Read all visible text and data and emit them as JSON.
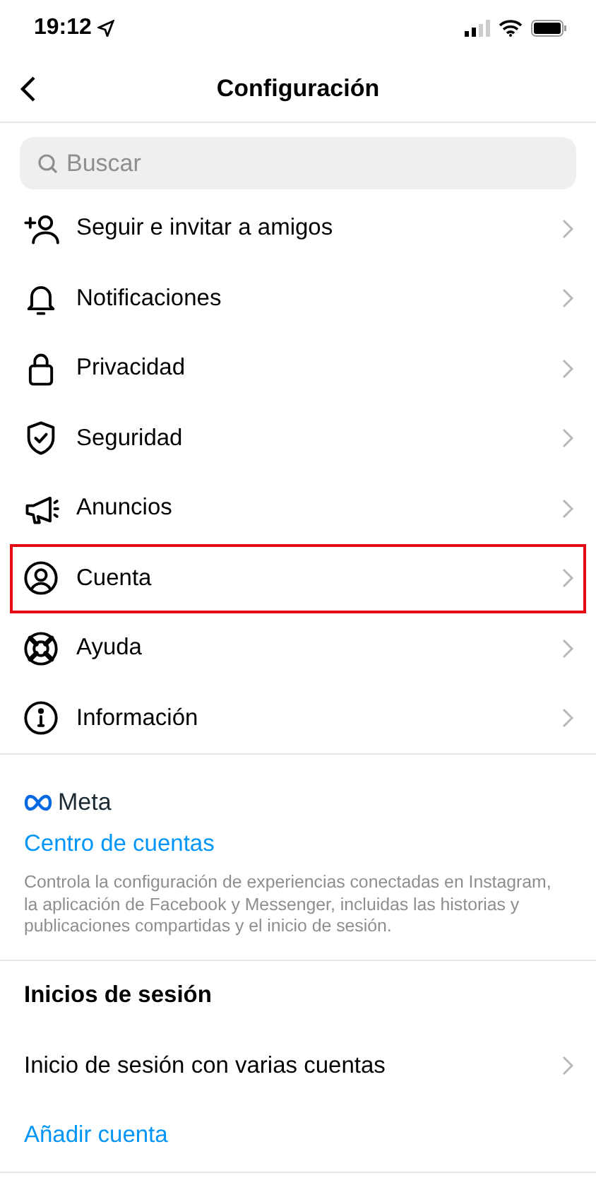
{
  "status_bar": {
    "time": "19:12"
  },
  "header": {
    "title": "Configuración"
  },
  "search": {
    "placeholder": "Buscar"
  },
  "menu": [
    {
      "label": "Seguir e invitar a amigos",
      "highlighted": false
    },
    {
      "label": "Notificaciones",
      "highlighted": false
    },
    {
      "label": "Privacidad",
      "highlighted": false
    },
    {
      "label": "Seguridad",
      "highlighted": false
    },
    {
      "label": "Anuncios",
      "highlighted": false
    },
    {
      "label": "Cuenta",
      "highlighted": true
    },
    {
      "label": "Ayuda",
      "highlighted": false
    },
    {
      "label": "Información",
      "highlighted": false
    }
  ],
  "meta": {
    "brand": "Meta",
    "link": "Centro de cuentas",
    "description": "Controla la configuración de experiencias conectadas en Instagram, la aplicación de Facebook y Messenger, incluidas las historias y publicaciones compartidas y el inicio de sesión."
  },
  "logins": {
    "heading": "Inicios de sesión",
    "items": [
      {
        "kind": "row",
        "label": "Inicio de sesión con varias cuentas"
      },
      {
        "kind": "link",
        "label": "Añadir cuenta"
      }
    ]
  }
}
